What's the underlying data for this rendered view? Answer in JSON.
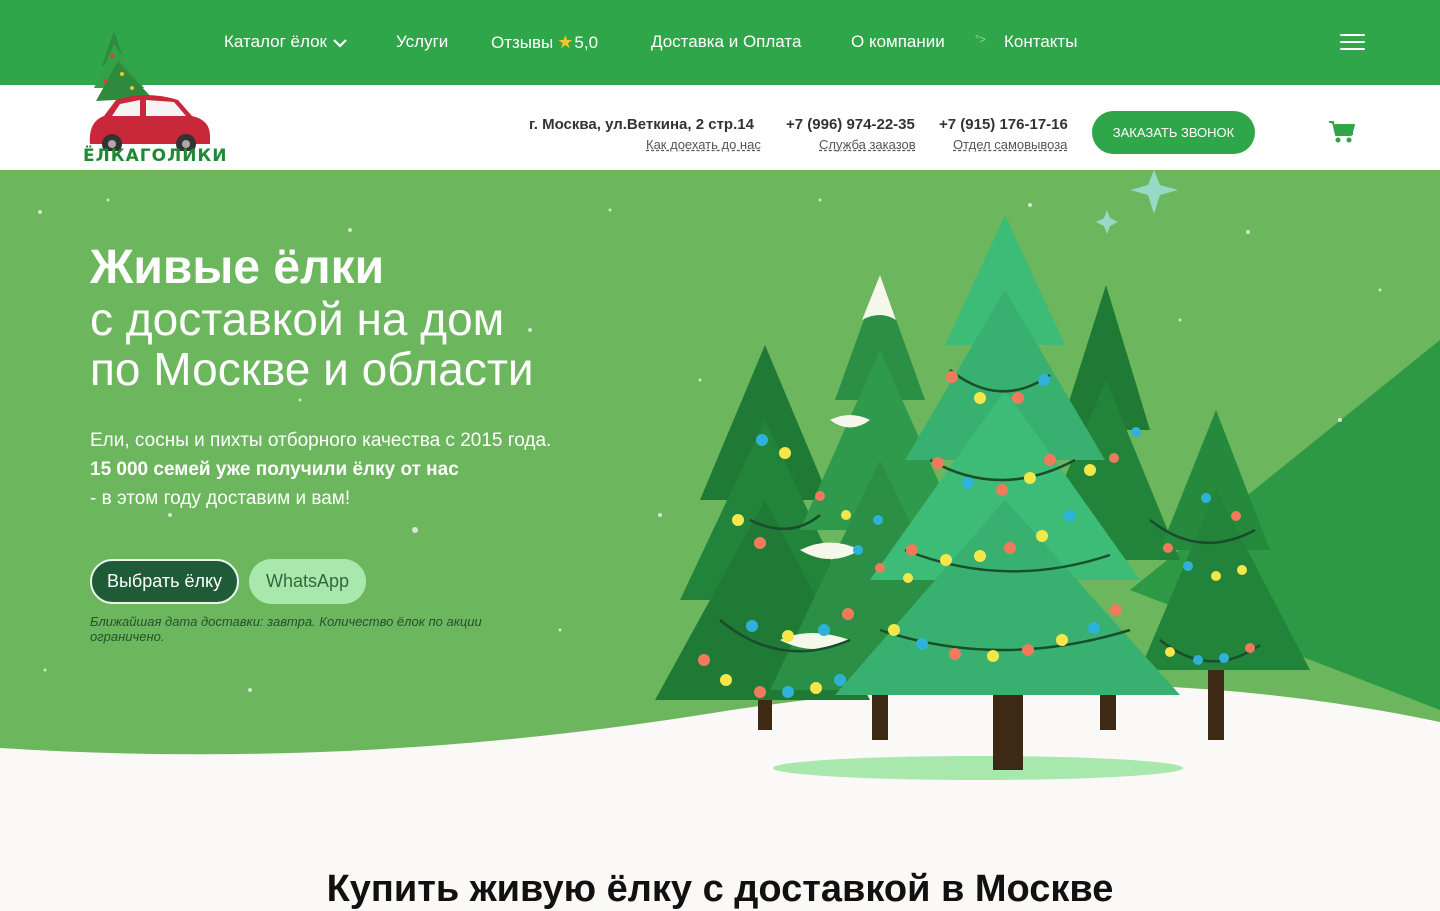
{
  "nav": {
    "items": [
      {
        "label": "Каталог ёлок"
      },
      {
        "label": "Услуги"
      },
      {
        "label": "Отзывы",
        "rating": "5,0"
      },
      {
        "label": "Доставка и Оплата"
      },
      {
        "label": "О компании"
      },
      {
        "label": "Контакты"
      }
    ],
    "separator": "°>"
  },
  "logo": {
    "text": "ЁЛКАГОЛИКИ"
  },
  "info": {
    "address": "г. Москва, ул.Веткина, 2 стр.14",
    "address_link": "Как доехать до нас",
    "phone1": "+7 (996) 974-22-35",
    "phone1_label": "Служба заказов",
    "phone2": "+7 (915) 176-17-16",
    "phone2_label": "Отдел самовывоза",
    "callback_label": "ЗАКАЗАТЬ ЗВОНОК"
  },
  "hero": {
    "title_bold": "Живые ёлки",
    "title_line2": "с доставкой на дом",
    "title_line3": "по Москве и области",
    "p1": "Ели, сосны и пихты отборного качества с 2015 года.",
    "p2": "15 000 семей уже получили ёлку от нас",
    "p3": "- в этом году доставим и вам!",
    "btn_choose": "Выбрать ёлку",
    "btn_whatsapp": "WhatsApp",
    "note": "Ближайшая дата доставки: завтра. Количество ёлок по акции ограничено."
  },
  "section": {
    "title": "Купить живую ёлку с доставкой в Москве"
  },
  "colors": {
    "brand_green": "#30a64a",
    "hero_green": "#6cb65d",
    "dark_green": "#1f5b36",
    "light_green": "#a8e8ad"
  }
}
